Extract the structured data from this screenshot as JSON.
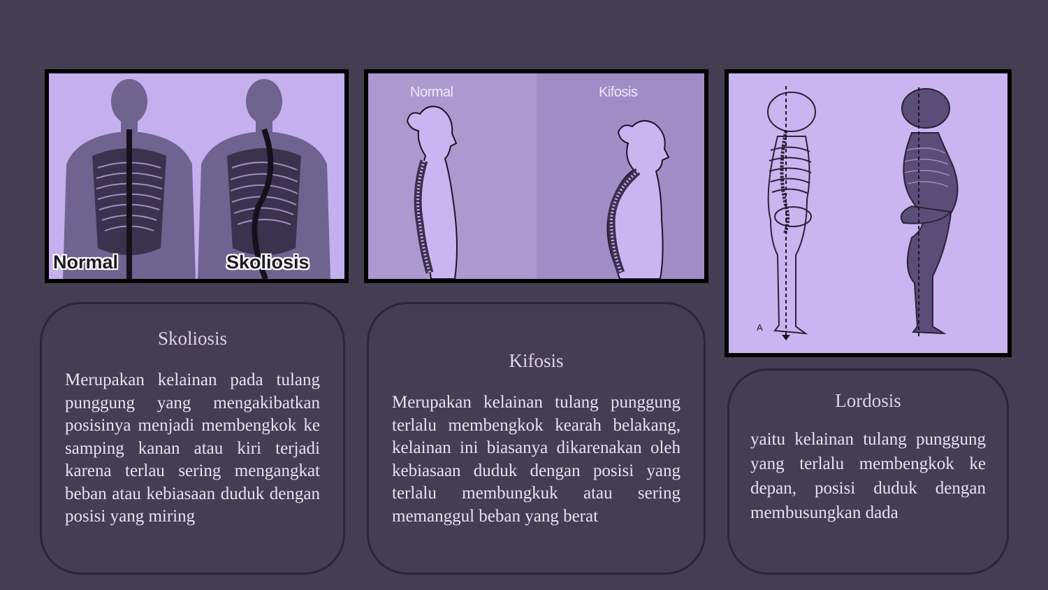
{
  "images": {
    "skoliosis": {
      "label_left": "Normal",
      "label_right": "Skoliosis"
    },
    "kifosis": {
      "label_left": "Normal",
      "label_right": "Kifosis"
    },
    "lordosis": {
      "label_corner": "A"
    }
  },
  "cards": [
    {
      "title": "Skoliosis",
      "body": "Merupakan kelainan pada tulang punggung yang mengakibatkan posisinya menjadi membengkok ke samping kanan atau kiri terjadi karena terlau sering mengangkat beban atau kebiasaan duduk dengan posisi yang miring"
    },
    {
      "title": "Kifosis",
      "body": "Merupakan kelainan tulang punggung terlalu membengkok kearah belakang, kelainan ini biasanya dikarenakan oleh kebiasaan duduk dengan posisi yang terlalu membungkuk atau sering memanggul beban yang berat"
    },
    {
      "title": "Lordosis",
      "body": "yaitu kelainan tulang punggung yang terlalu membengkok ke depan, posisi duduk dengan membusungkan dada"
    }
  ],
  "colors": {
    "background": "#453d52",
    "image_tint": "#c9b5ef",
    "text": "#e8e0f6"
  }
}
